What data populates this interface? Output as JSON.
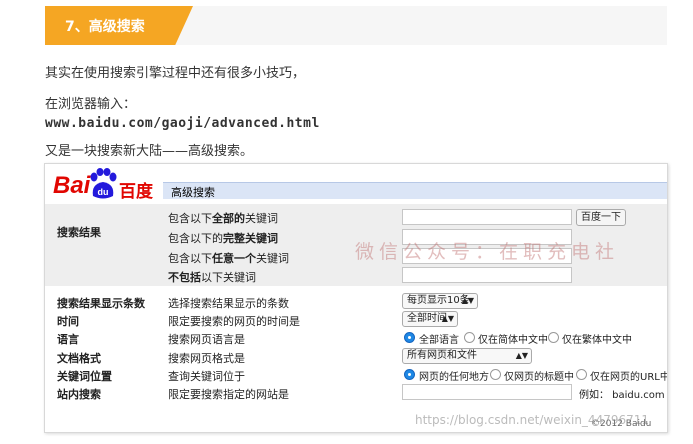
{
  "section": {
    "title": "7、高级搜索"
  },
  "paragraphs": {
    "p1": "其实在使用搜索引擎过程中还有很多小技巧，",
    "p2": "在浏览器输入：",
    "p3": "www.baidu.com/gaoji/advanced.html",
    "p4": "又是一块搜索新大陆——高级搜索。"
  },
  "screenshot": {
    "logo": {
      "latin": "Bai",
      "paw": "du",
      "chinese": "百度"
    },
    "header_title": "高级搜索",
    "keywords": {
      "section_label": "搜索结果",
      "rows": [
        {
          "prefix": "包含以下",
          "emph": "全部的",
          "suffix": "关键词"
        },
        {
          "prefix": "包含以下的",
          "emph": "完整关键词",
          "suffix": ""
        },
        {
          "prefix": "包含以下",
          "emph": "任意一个",
          "suffix": "关键词"
        },
        {
          "prefix": "",
          "emph": "不包括",
          "suffix": "以下关键词"
        }
      ],
      "button_label": "百度一下"
    },
    "options": [
      {
        "label": "搜索结果显示条数",
        "desc": "选择搜索结果显示的条数",
        "select": "每页显示10条"
      },
      {
        "label": "时间",
        "desc": "限定要搜索的网页的时间是",
        "select": "全部时间"
      },
      {
        "label": "语言",
        "desc": "搜索网页语言是",
        "radios": [
          "全部语言",
          "仅在简体中文中",
          "仅在繁体中文中"
        ]
      },
      {
        "label": "文档格式",
        "desc": "搜索网页格式是",
        "select": "所有网页和文件"
      },
      {
        "label": "关键词位置",
        "desc": "查询关键词位于",
        "radios": [
          "网页的任何地方",
          "仅网页的标题中",
          "仅在网页的URL中"
        ]
      },
      {
        "label": "站内搜索",
        "desc": "限定要搜索指定的网站是",
        "example": "例如：  baidu.com"
      }
    ],
    "copyright": "©2012 Baidu"
  },
  "watermark": "微信公众号：在职充电社",
  "url_watermark": "https://blog.csdn.net/weixin_44796711",
  "colors": {
    "accent": "#f5a623",
    "baidu_red": "#e10601",
    "baidu_blue": "#2319dc",
    "radio_selected": "#1e88e5"
  }
}
